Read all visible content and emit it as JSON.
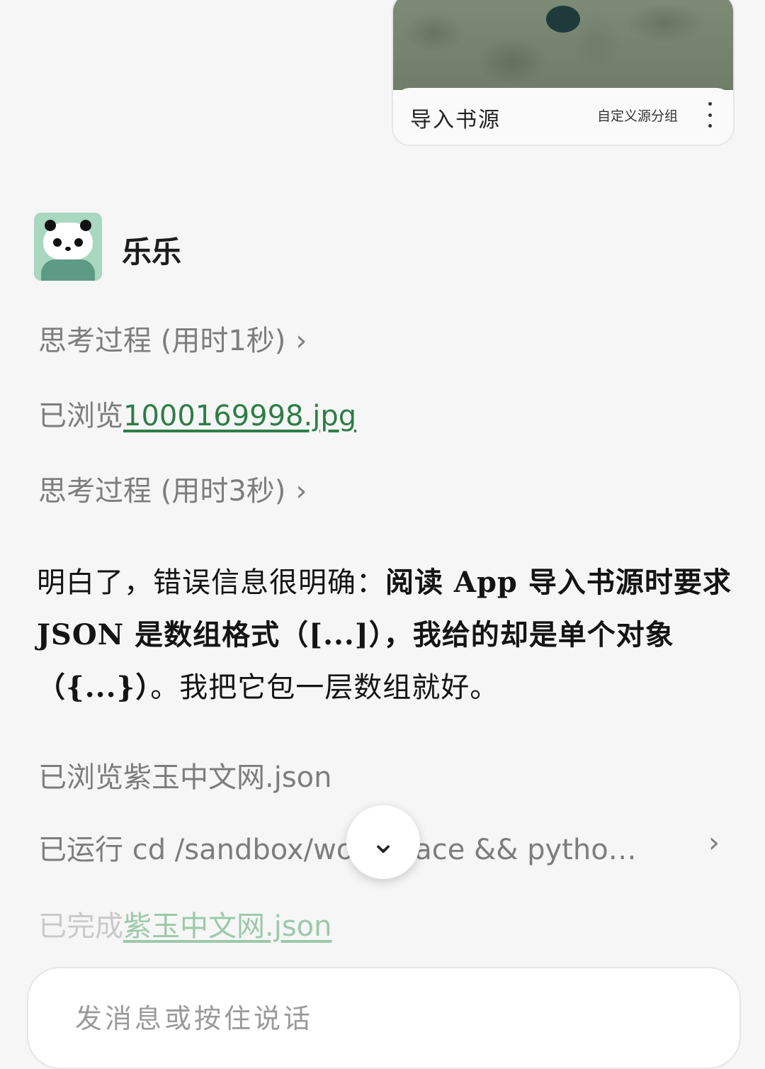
{
  "shared_card": {
    "title": "导入书源",
    "subtitle": "自定义源分组",
    "more_icon": "more-vertical-icon"
  },
  "contact": {
    "name": "乐乐",
    "avatar_icon": "panda-avatar"
  },
  "steps": [
    {
      "label": "思考过程 (用时1秒)",
      "icon": "chevron-right-icon"
    },
    {
      "prefix": "已浏览",
      "file": "1000169998.jpg"
    },
    {
      "label": "思考过程 (用时3秒)",
      "icon": "chevron-right-icon"
    }
  ],
  "message": {
    "part1": "明白了，错误信息很明确：",
    "bold1": "阅读 App 导入书源时要求 JSON 是数组格式（[...]），我给的却是单个对象（{...}）",
    "part2": "。我把它包一层数组就好。"
  },
  "actions": [
    {
      "label": "已浏览紫玉中文网.json"
    },
    {
      "label": "已运行 cd /sandbox/workspace && pytho…",
      "icon": "chevron-right-icon"
    },
    {
      "prefix": "已完成",
      "file": "紫玉中文网.json"
    }
  ],
  "scroll_button_icon": "chevron-down-icon",
  "input": {
    "placeholder": "发消息或按住说话"
  },
  "colors": {
    "link": "#2e7d46",
    "muted": "#7d7d7d",
    "background": "#f6f6f6"
  }
}
